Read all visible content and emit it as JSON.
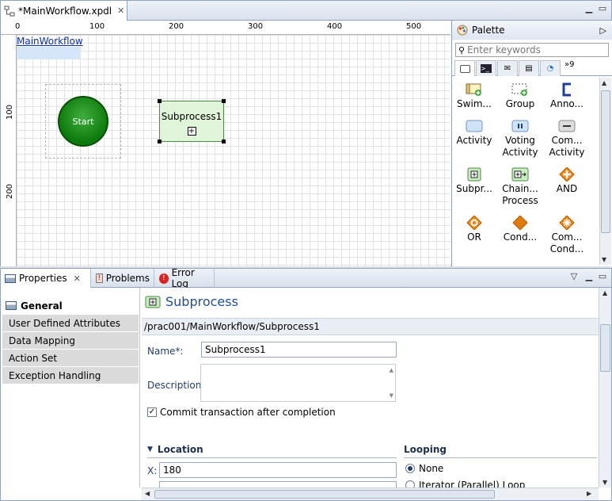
{
  "editor": {
    "tab_title": "*MainWorkflow.xpdl",
    "ruler_top_ticks": [
      "0",
      "100",
      "200",
      "300",
      "400",
      "500"
    ],
    "ruler_left_ticks": [
      "100",
      "200"
    ],
    "pool_label": "MainWorkflow",
    "start_label": "Start",
    "subprocess_label": "Subprocess1"
  },
  "palette": {
    "title": "Palette",
    "search_placeholder": "Enter keywords",
    "tabs_more_count": "9",
    "items": [
      {
        "label": "Swim...",
        "icon": "swimlane-icon"
      },
      {
        "label": "Group",
        "icon": "group-icon"
      },
      {
        "label": "Anno...",
        "icon": "annotation-icon"
      },
      {
        "label": "Activity",
        "icon": "activity-icon"
      },
      {
        "label": "Voting Activity",
        "icon": "voting-activity-icon"
      },
      {
        "label": "Com... Activity",
        "icon": "compensation-activity-icon"
      },
      {
        "label": "Subpr...",
        "icon": "subprocess-icon"
      },
      {
        "label": "Chain... Process",
        "icon": "chained-process-icon"
      },
      {
        "label": "AND",
        "icon": "and-gateway-icon"
      },
      {
        "label": "OR",
        "icon": "or-gateway-icon"
      },
      {
        "label": "Cond...",
        "icon": "conditional-gateway-icon"
      },
      {
        "label": "Com... Cond...",
        "icon": "complex-gateway-icon"
      }
    ]
  },
  "properties": {
    "tabs": [
      "Properties",
      "Problems",
      "Error Log"
    ],
    "sidebar": [
      "General",
      "User Defined Attributes",
      "Data Mapping",
      "Action Set",
      "Exception Handling"
    ],
    "title": "Subprocess",
    "path": "/prac001/MainWorkflow/Subprocess1",
    "name_label": "Name*:",
    "name_value": "Subprocess1",
    "description_label": "Description:",
    "commit_label": "Commit transaction after completion",
    "location_heading": "Location",
    "x_label": "X:",
    "x_value": "180",
    "looping_heading": "Looping",
    "looping_none": "None",
    "looping_iterator": "Iterator (Parallel) Loop"
  }
}
